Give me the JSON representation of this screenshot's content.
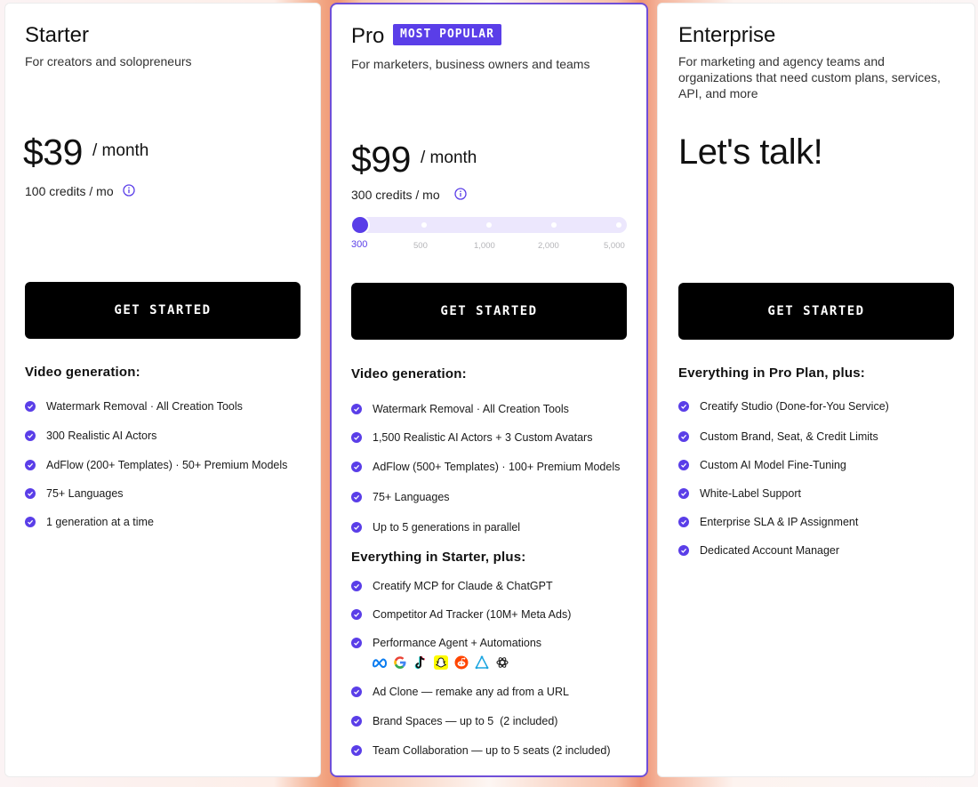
{
  "plans": {
    "starter": {
      "name": "Starter",
      "tagline": "For creators and solopreneurs",
      "price": "$39",
      "period": "/ month",
      "credits": "100 credits / mo",
      "cta": "GET STARTED",
      "section_title": "Video generation:",
      "features": [
        "Watermark Removal · All Creation Tools",
        "300 Realistic AI Actors",
        "AdFlow (200+ Templates) · 50+ Premium Models",
        "75+ Languages",
        "1 generation at a time"
      ]
    },
    "pro": {
      "name": "Pro",
      "badge": "MOST POPULAR",
      "tagline": "For marketers, business owners and teams",
      "price": "$99",
      "period": "/ month",
      "credits": "300 credits / mo",
      "slider": {
        "selected": "300",
        "options": [
          "300",
          "500",
          "1,000",
          "2,000",
          "5,000"
        ]
      },
      "cta": "GET STARTED",
      "section_title": "Video generation:",
      "features": [
        "Watermark Removal · All Creation Tools",
        "1,500 Realistic AI Actors + 3 Custom Avatars",
        "AdFlow (500+ Templates) · 100+ Premium Models",
        "75+ Languages",
        "Up to 5 generations in parallel"
      ],
      "section_title_2": "Everything in Starter, plus:",
      "features_2": [
        "Creatify MCP for Claude & ChatGPT",
        "Competitor Ad Tracker (10M+ Meta Ads)",
        "Performance Agent + Automations",
        "Ad Clone — remake any ad from a URL",
        "Brand Spaces — up to 5  (2 included)",
        "Team Collaboration — up to 5 seats (2 included)"
      ],
      "integrations": [
        "meta-icon",
        "google-icon",
        "tiktok-icon",
        "snapchat-icon",
        "reddit-icon",
        "applovin-icon",
        "openai-icon"
      ]
    },
    "enterprise": {
      "name": "Enterprise",
      "tagline": "For marketing and agency teams and organizations that need custom plans, services, API, and more",
      "price": "Let's talk!",
      "cta": "GET STARTED",
      "section_title": "Everything in Pro Plan, plus:",
      "features": [
        "Creatify Studio (Done-for-You Service)",
        "Custom Brand, Seat, & Credit Limits",
        "Custom AI Model Fine-Tuning",
        "White-Label Support",
        "Enterprise SLA & IP Assignment",
        "Dedicated Account Manager"
      ]
    }
  },
  "colors": {
    "accent": "#5a3ee8",
    "pro_border": "#6f4fd8",
    "cta_bg": "#000000"
  }
}
